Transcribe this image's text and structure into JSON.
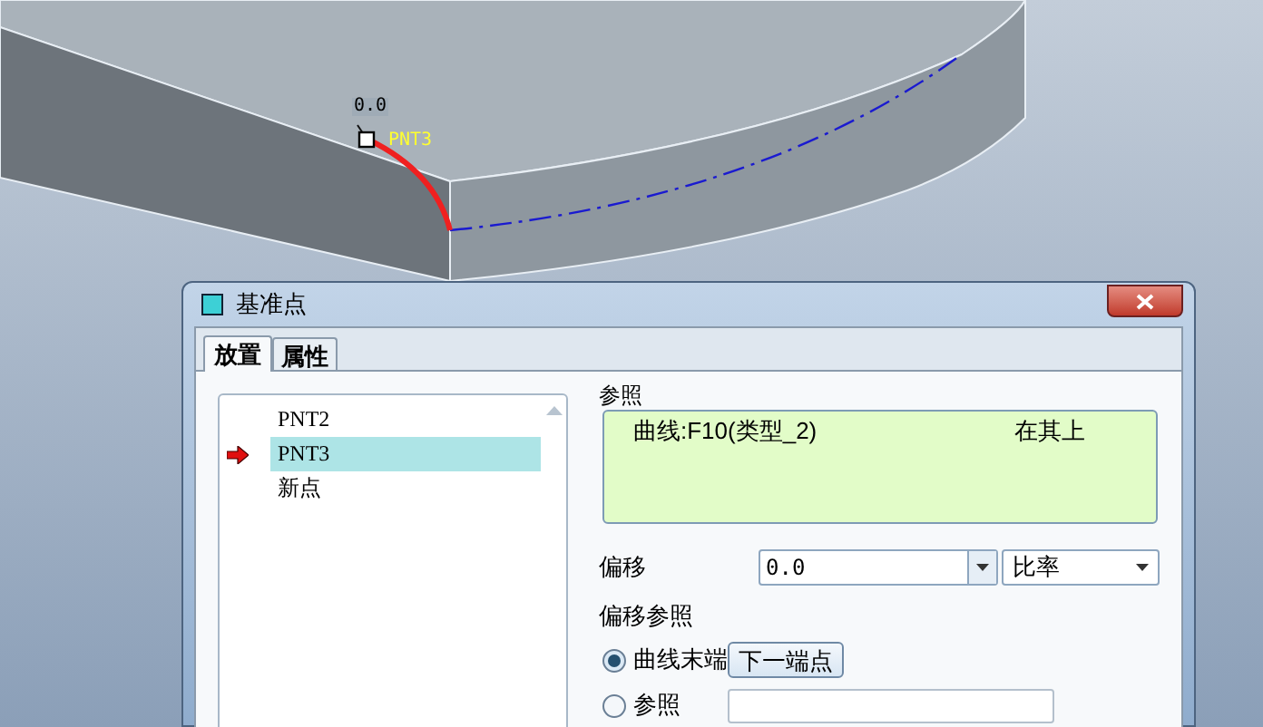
{
  "viewport": {
    "offset_label": "0.0",
    "point_label": "PNT3"
  },
  "dialog": {
    "title": "基准点",
    "tabs": [
      {
        "label": "放置",
        "selected": true
      },
      {
        "label": "属性",
        "selected": false
      }
    ],
    "points": [
      {
        "label": "PNT2",
        "selected": false
      },
      {
        "label": "PNT3",
        "selected": true
      },
      {
        "label": "新点",
        "selected": false
      }
    ],
    "references_label": "参照",
    "references": [
      {
        "reference": "曲线:F10(类型_2)",
        "constraint": "在其上"
      }
    ],
    "offset_label": "偏移",
    "offset_value": "0.0",
    "offset_unit": "比率",
    "offset_reference_label": "偏移参照",
    "offset_options": [
      {
        "kind": "button",
        "label": "曲线末端",
        "selected": true,
        "button": "下一端点"
      },
      {
        "kind": "field",
        "label": "参照",
        "selected": false
      }
    ]
  }
}
